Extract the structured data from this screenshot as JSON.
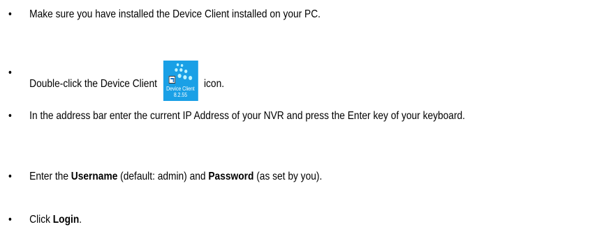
{
  "bullet": "•",
  "items": [
    {
      "text": "Make sure you have installed the Device Client installed on your PC."
    },
    {
      "before": "Double-click the Device Client",
      "after": "icon."
    },
    {
      "text": "In the address bar enter the current IP Address of your NVR and press the Enter key of your keyboard."
    },
    {
      "before": "Enter the ",
      "username": "Username",
      "middle": " (default: admin) and ",
      "password": "Password",
      "after": " (as set by you)."
    },
    {
      "before": "Click ",
      "login": "Login",
      "after": "."
    }
  ],
  "app_icon": {
    "name": "Device Client",
    "version": "8.2.55",
    "icon": "device-client-app-icon",
    "color": "#1aa0e6"
  }
}
